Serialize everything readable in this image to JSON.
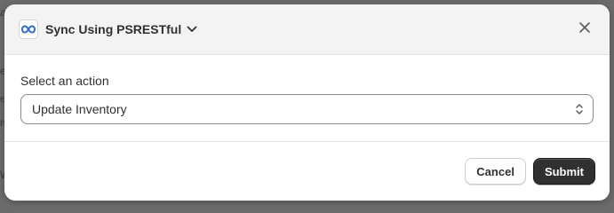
{
  "background_fragments": [
    "a",
    "e",
    "e",
    "m",
    "W"
  ],
  "modal": {
    "header": {
      "app_icon": "infinity-icon",
      "title": "Sync Using PSRESTful",
      "dropdown_icon": "chevron-down-icon",
      "close_icon": "close-icon"
    },
    "body": {
      "field_label": "Select an action",
      "select_value": "Update Inventory",
      "select_icon": "select-arrows-icon"
    },
    "footer": {
      "cancel_label": "Cancel",
      "submit_label": "Submit"
    }
  },
  "colors": {
    "accent_icon": "#2c6ecb",
    "primary_button": "#303030",
    "header_bg": "#f3f3f3",
    "overlay": "#6b6b6b"
  }
}
